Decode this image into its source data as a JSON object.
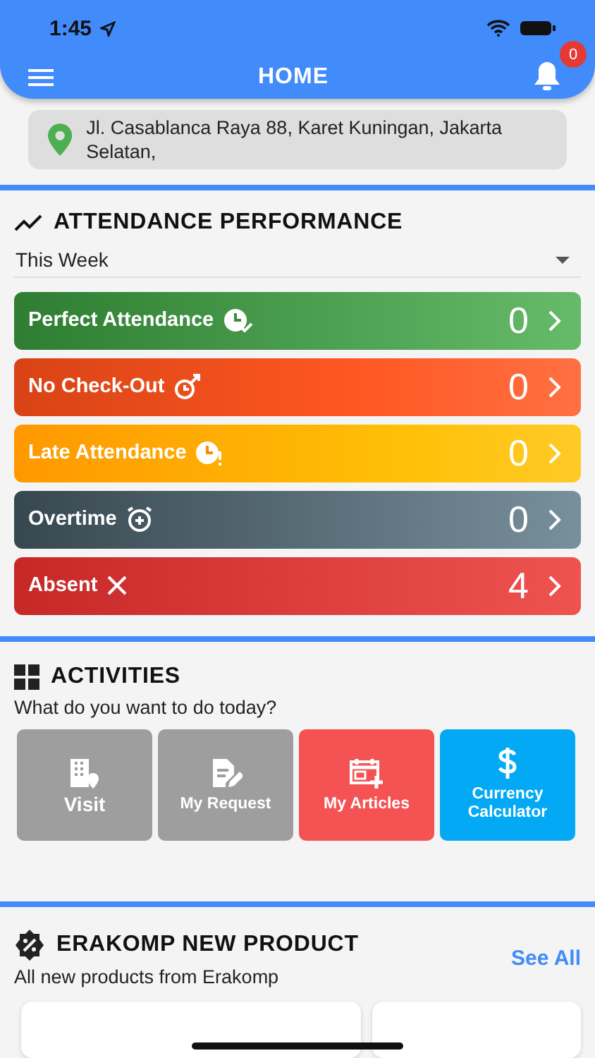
{
  "status_bar": {
    "time": "1:45"
  },
  "header": {
    "title": "HOME",
    "notification_count": "0"
  },
  "address": "Jl. Casablanca Raya 88, Karet Kuningan, Jakarta Selatan,",
  "attendance": {
    "title": "ATTENDANCE PERFORMANCE",
    "period": "This Week",
    "rows": [
      {
        "kind": "perfect",
        "label": "Perfect Attendance",
        "count": "0"
      },
      {
        "kind": "nocheckout",
        "label": "No Check-Out",
        "count": "0"
      },
      {
        "kind": "late",
        "label": "Late Attendance",
        "count": "0"
      },
      {
        "kind": "overtime",
        "label": "Overtime",
        "count": "0"
      },
      {
        "kind": "absent",
        "label": "Absent",
        "count": "4"
      }
    ]
  },
  "activities": {
    "title": "ACTIVITIES",
    "subtitle": "What do you want to do today?",
    "tiles": [
      {
        "kind": "visit",
        "label": "Visit",
        "color": "#9e9e9e"
      },
      {
        "kind": "request",
        "label": "My Request",
        "color": "#9e9e9e"
      },
      {
        "kind": "articles",
        "label": "My Articles",
        "color": "#f55253"
      },
      {
        "kind": "currency",
        "label": "Currency Calculator",
        "color": "#03a9f4"
      }
    ]
  },
  "products": {
    "title": "ERAKOMP NEW PRODUCT",
    "subtitle": "All new products from Erakomp",
    "see_all": "See All"
  }
}
